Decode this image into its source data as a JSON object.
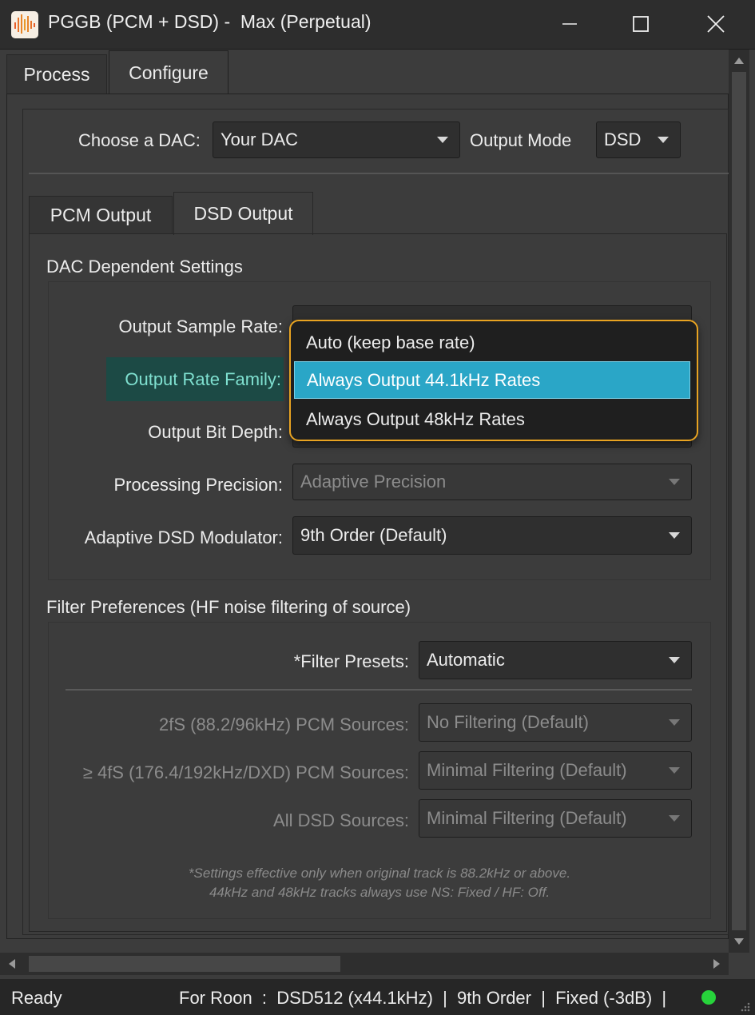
{
  "window": {
    "title": "PGGB (PCM + DSD) -  Max (Perpetual)",
    "icon": "pggb-app-icon",
    "controls": [
      "minimize-icon",
      "maximize-icon",
      "close-icon"
    ]
  },
  "main_tabs": [
    {
      "label": "Process",
      "active": false
    },
    {
      "label": "Configure",
      "active": true
    }
  ],
  "dac": {
    "label": "Choose a DAC:",
    "value": "Your DAC",
    "output_mode_label": "Output Mode",
    "output_mode_value": "DSD"
  },
  "output_tabs": [
    {
      "label": "PCM Output",
      "active": false
    },
    {
      "label": "DSD Output",
      "active": true
    }
  ],
  "dac_settings": {
    "heading": "DAC Dependent Settings",
    "sample_rate_label": "Output Sample Rate:",
    "rate_family_label": "Output Rate Family:",
    "bit_depth_label": "Output Bit Depth:",
    "precision_label": "Processing Precision:",
    "precision_value": "Adaptive Precision",
    "modulator_label": "Adaptive DSD Modulator:",
    "modulator_value": "9th Order (Default)"
  },
  "dropdown": {
    "options": [
      {
        "label": "Auto (keep base rate)",
        "selected": false
      },
      {
        "label": "Always Output 44.1kHz Rates",
        "selected": true
      },
      {
        "label": "Always Output 48kHz Rates",
        "selected": false
      }
    ]
  },
  "filters": {
    "heading": "Filter Preferences (HF noise filtering of source)",
    "presets_label": "*Filter Presets:",
    "presets_value": "Automatic",
    "rows": [
      {
        "label": "2fS (88.2/96kHz) PCM Sources:",
        "value": "No Filtering (Default)"
      },
      {
        "label": "≥ 4fS (176.4/192kHz/DXD) PCM Sources:",
        "value": "Minimal Filtering (Default)"
      },
      {
        "label": "All DSD Sources:",
        "value": "Minimal Filtering (Default)"
      }
    ],
    "note_line1": "*Settings effective only when original track is 88.2kHz or above.",
    "note_line2": "44kHz and 48kHz tracks always use NS: Fixed / HF: Off."
  },
  "status": {
    "ready": "Ready",
    "info": "For Roon  :  DSD512 (x44.1kHz)  |  9th Order  |  Fixed (-3dB)  |",
    "indicator_color": "#27d33b"
  },
  "colors": {
    "accent_highlight": "#2aa6c7",
    "focus_label_bg": "#1c4a45",
    "focus_label_text": "#7fe0d0",
    "popup_border": "#e8a321"
  }
}
